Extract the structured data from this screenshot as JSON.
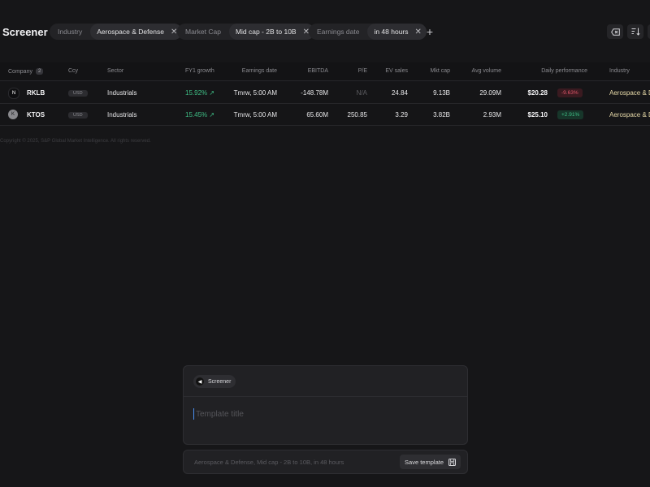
{
  "app": {
    "title": "Screener"
  },
  "filters": [
    {
      "key": "Industry",
      "value": "Aerospace & Defense"
    },
    {
      "key": "Market Cap",
      "value": "Mid cap - 2B to 10B"
    },
    {
      "key": "Earnings date",
      "value": "in 48 hours"
    }
  ],
  "icons": {
    "add": "plus-icon",
    "clear": "backspace-icon",
    "sort": "sort-icon",
    "save": "save-icon",
    "close": "close-icon"
  },
  "table": {
    "headers": {
      "company": "Company",
      "company_count": "2",
      "ccy": "Ccy",
      "sector": "Sector",
      "fy1_growth": "FY1 growth",
      "earnings_date": "Earnings date",
      "ebitda": "EBITDA",
      "pe": "P/E",
      "ev_sales": "EV sales",
      "mkt_cap": "Mkt cap",
      "avg_volume": "Avg volume",
      "daily_performance": "Daily performance",
      "industry": "Industry"
    },
    "rows": [
      {
        "logo": "N",
        "ticker": "RKLB",
        "ccy": "USD",
        "sector": "Industrials",
        "fy1_growth": "15.92% ↗",
        "earnings_date": "Tmrw, 5:00 AM",
        "ebitda": "-148.78M",
        "pe": "N/A",
        "ev_sales": "24.84",
        "mkt_cap": "9.13B",
        "avg_volume": "29.09M",
        "price": "$20.28",
        "daily_performance": "-9.63%",
        "industry": "Aerospace & Defense"
      },
      {
        "logo": "K",
        "ticker": "KTOS",
        "ccy": "USD",
        "sector": "Industrials",
        "fy1_growth": "15.45% ↗",
        "earnings_date": "Tmrw, 5:00 AM",
        "ebitda": "65.60M",
        "pe": "250.85",
        "ev_sales": "3.29",
        "mkt_cap": "3.82B",
        "avg_volume": "2.93M",
        "price": "$25.10",
        "daily_performance": "+2.91%",
        "industry": "Aerospace & Defense"
      }
    ]
  },
  "footer": {
    "copyright": "Copyright © 2025, S&P Global Market Intelligence. All rights reserved."
  },
  "composer": {
    "source_pill": "Screener",
    "title_placeholder": "Template title",
    "summary": "Aerospace & Defense, Mid cap - 2B to 10B, in 48 hours",
    "save_label": "Save template"
  },
  "colors": {
    "background": "#161618",
    "positive": "#3fbf86",
    "negative": "#e0566a",
    "accent": "#4a8ff0"
  }
}
